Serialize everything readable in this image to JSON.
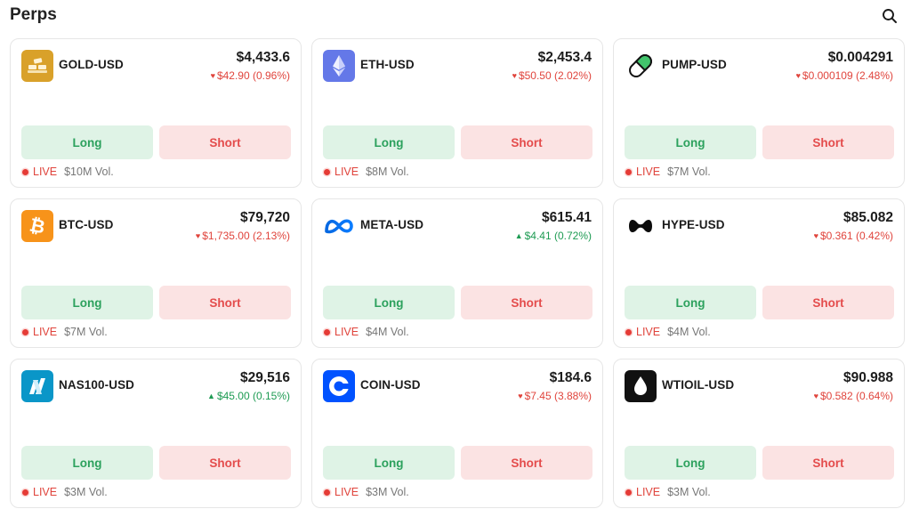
{
  "header": {
    "title": "Perps"
  },
  "buttons": {
    "long_label": "Long",
    "short_label": "Short"
  },
  "status": {
    "live_label": "LIVE"
  },
  "colors": {
    "long_bg": "#dff3e6",
    "long_text": "#2ca15d",
    "short_bg": "#fbe3e3",
    "short_text": "#e44c4c",
    "down": "#e0443c",
    "up": "#1e9b53"
  },
  "markets": [
    {
      "symbol": "GOLD-USD",
      "icon": "gold-bars-icon",
      "price": "$4,433.6",
      "direction": "down",
      "change": "$42.90 (0.96%)",
      "volume": "$10M Vol."
    },
    {
      "symbol": "ETH-USD",
      "icon": "ethereum-icon",
      "price": "$2,453.4",
      "direction": "down",
      "change": "$50.50 (2.02%)",
      "volume": "$8M Vol."
    },
    {
      "symbol": "PUMP-USD",
      "icon": "pill-icon",
      "price": "$0.004291",
      "direction": "down",
      "change": "$0.000109 (2.48%)",
      "volume": "$7M Vol."
    },
    {
      "symbol": "BTC-USD",
      "icon": "bitcoin-icon",
      "price": "$79,720",
      "direction": "down",
      "change": "$1,735.00 (2.13%)",
      "volume": "$7M Vol."
    },
    {
      "symbol": "META-USD",
      "icon": "meta-infinity-icon",
      "price": "$615.41",
      "direction": "up",
      "change": "$4.41 (0.72%)",
      "volume": "$4M Vol."
    },
    {
      "symbol": "HYPE-USD",
      "icon": "hype-icon",
      "price": "$85.082",
      "direction": "down",
      "change": "$0.361 (0.42%)",
      "volume": "$4M Vol."
    },
    {
      "symbol": "NAS100-USD",
      "icon": "nasdaq-icon",
      "price": "$29,516",
      "direction": "up",
      "change": "$45.00 (0.15%)",
      "volume": "$3M Vol."
    },
    {
      "symbol": "COIN-USD",
      "icon": "coinbase-icon",
      "price": "$184.6",
      "direction": "down",
      "change": "$7.45 (3.88%)",
      "volume": "$3M Vol."
    },
    {
      "symbol": "WTIOIL-USD",
      "icon": "oil-drop-icon",
      "price": "$90.988",
      "direction": "down",
      "change": "$0.582 (0.64%)",
      "volume": "$3M Vol."
    }
  ]
}
